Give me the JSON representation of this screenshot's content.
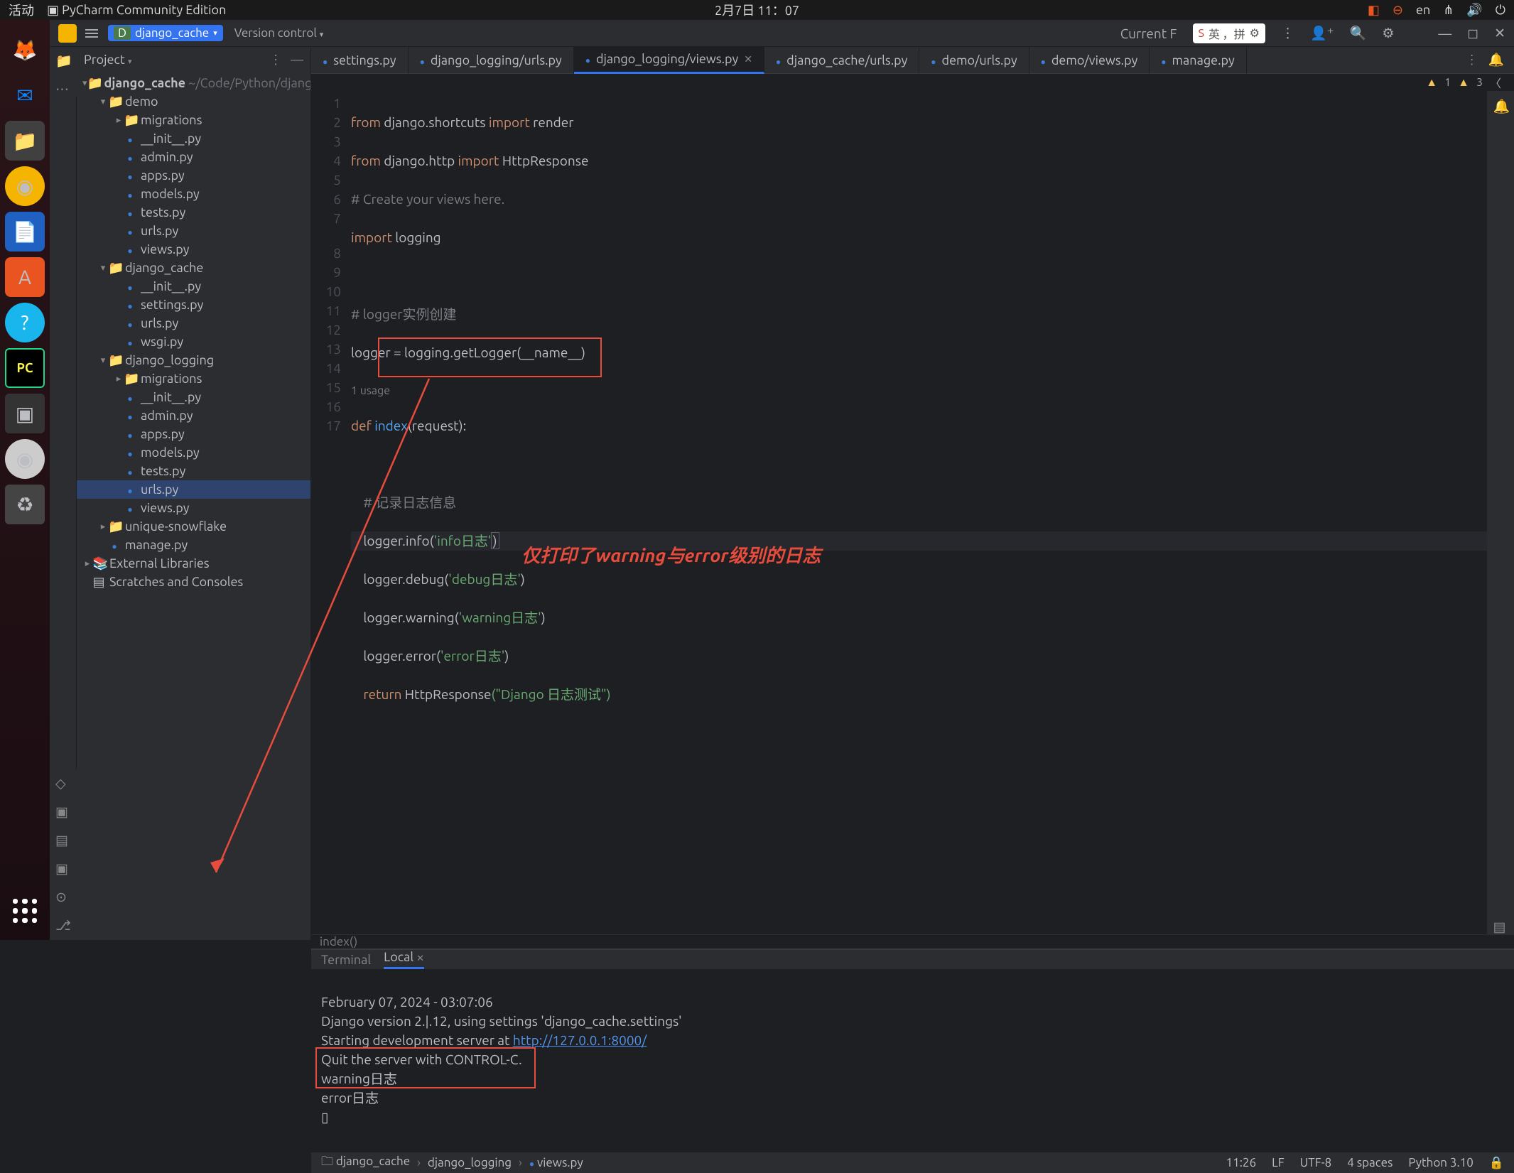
{
  "system": {
    "activities": "活动",
    "app_name": "PyCharm Community Edition",
    "datetime": "2月7日  11：07",
    "lang": "en",
    "ime_text": "英  ，拼"
  },
  "toolbar": {
    "project_name": "django_cache",
    "version_control": "Version control",
    "current_label": "Current F"
  },
  "project_panel": {
    "title": "Project",
    "root": "django_cache",
    "root_path": "~/Code/Python/django_cache",
    "tree": {
      "demo": "demo",
      "migrations1": "migrations",
      "initpy": "__init__.py",
      "adminpy": "admin.py",
      "appspy": "apps.py",
      "modelspy": "models.py",
      "testspy": "tests.py",
      "urlspy": "urls.py",
      "viewspy": "views.py",
      "dc": "django_cache",
      "settingspy": "settings.py",
      "wsgipy": "wsgi.py",
      "dl": "django_logging",
      "uniquesnow": "unique-snowflake",
      "managepy": "manage.py",
      "extlib": "External Libraries",
      "scratches": "Scratches and Consoles"
    }
  },
  "tabs": {
    "t1": "settings.py",
    "t2": "django_logging/urls.py",
    "t3": "django_logging/views.py",
    "t4": "django_cache/urls.py",
    "t5": "demo/urls.py",
    "t6": "demo/views.py",
    "t7": "manage.py"
  },
  "inspections": {
    "warn_count": "1",
    "typo_count": "3"
  },
  "code": {
    "l1_kw1": "from",
    "l1_mod": " django.shortcuts ",
    "l1_kw2": "import",
    "l1_name": " render",
    "l2_kw1": "from",
    "l2_mod": " django.http ",
    "l2_kw2": "import",
    "l2_name": " HttpResponse",
    "l3": "# Create your views here.",
    "l4_kw": "import",
    "l4_name": " logging",
    "l6": "# logger实例创建",
    "l7_pre": "logger = logging.getLogger(",
    "l7_str": "__name__",
    "l7_post": ")",
    "usage": "1 usage",
    "l8_def": "def ",
    "l8_fn": "index",
    "l8_par": "(request):",
    "l10": "    # 记录日志信息",
    "l11_pre": "    logger.info(",
    "l11_str": "'info日志'",
    "l11_post": ")",
    "l12_pre": "    logger.debug(",
    "l12_str": "'debug日志'",
    "l12_post": ")",
    "l13_pre": "    logger.warning(",
    "l13_str": "'warning日志'",
    "l13_post": ")",
    "l14_pre": "    logger.error(",
    "l14_str": "'error日志'",
    "l14_post": ")",
    "l15_ret": "    return ",
    "l15_fn": "HttpResponse",
    "l15_str": "(\"Django 日志测试\")"
  },
  "editor_crumb": "index()",
  "annotation": "仅打印了warning与error级别的日志",
  "terminal": {
    "tab1": "Terminal",
    "tab2": "Local",
    "line1": "February 07, 2024 - 03:07:06",
    "line2_a": "Django version 2.",
    "line2_b": ".12, using settings 'django_cache.settings'",
    "line3_a": "Starting development server at ",
    "line3_link": "http://127.0.0.1:8000/",
    "line4": "Quit the server with CONTROL-C.",
    "out1": "warning日志",
    "out2": "error日志",
    "prompt": "▯"
  },
  "statusbar": {
    "bc1": "django_cache",
    "bc2": "django_logging",
    "bc3": "views.py",
    "pos": "11:26",
    "le": "LF",
    "enc": "UTF-8",
    "indent": "4 spaces",
    "interp": "Python 3.10"
  },
  "gutter": {
    "n1": "1",
    "n2": "2",
    "n3": "3",
    "n4": "4",
    "n5": "5",
    "n6": "6",
    "n7": "7",
    "n8": "8",
    "n9": "9",
    "n10": "10",
    "n11": "11",
    "n12": "12",
    "n13": "13",
    "n14": "14",
    "n15": "15",
    "n16": "16",
    "n17": "17"
  }
}
